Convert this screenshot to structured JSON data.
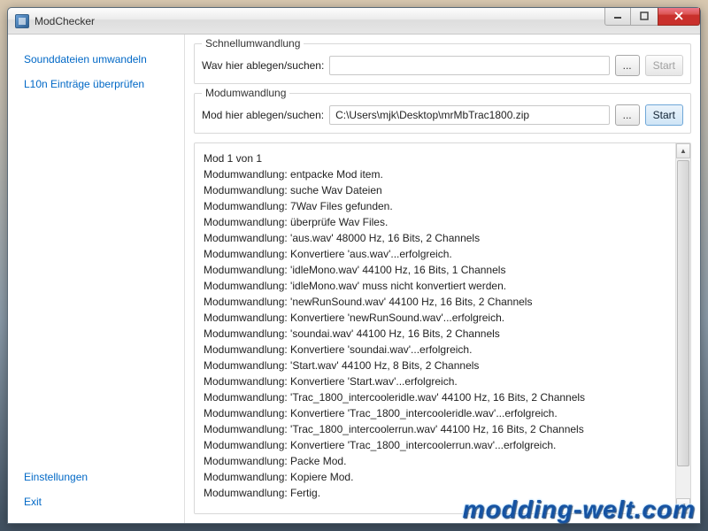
{
  "window": {
    "title": "ModChecker"
  },
  "sidebar": {
    "top": [
      {
        "label": "Sounddateien umwandeln"
      },
      {
        "label": "L10n Einträge überprüfen"
      }
    ],
    "bottom": [
      {
        "label": "Einstellungen"
      },
      {
        "label": "Exit"
      }
    ]
  },
  "quick": {
    "title": "Schnellumwandlung",
    "label": "Wav hier ablegen/suchen:",
    "value": "",
    "browse": "...",
    "start": "Start"
  },
  "mod": {
    "title": "Modumwandlung",
    "label": "Mod hier ablegen/suchen:",
    "value": "C:\\Users\\mjk\\Desktop\\mrMbTrac1800.zip",
    "browse": "...",
    "start": "Start"
  },
  "log_lines": [
    "Mod 1 von 1",
    "Modumwandlung: entpacke Mod item.",
    "Modumwandlung: suche Wav Dateien",
    "Modumwandlung: 7Wav Files gefunden.",
    "Modumwandlung: überprüfe Wav Files.",
    "Modumwandlung: 'aus.wav' 48000 Hz, 16 Bits, 2 Channels",
    "Modumwandlung: Konvertiere 'aus.wav'...erfolgreich.",
    "Modumwandlung: 'idleMono.wav' 44100 Hz, 16 Bits, 1 Channels",
    "Modumwandlung: 'idleMono.wav' muss nicht konvertiert werden.",
    "Modumwandlung: 'newRunSound.wav' 44100 Hz, 16 Bits, 2 Channels",
    "Modumwandlung: Konvertiere 'newRunSound.wav'...erfolgreich.",
    "Modumwandlung: 'soundai.wav' 44100 Hz, 16 Bits, 2 Channels",
    "Modumwandlung: Konvertiere 'soundai.wav'...erfolgreich.",
    "Modumwandlung: 'Start.wav' 44100 Hz, 8 Bits, 2 Channels",
    "Modumwandlung: Konvertiere 'Start.wav'...erfolgreich.",
    "Modumwandlung: 'Trac_1800_intercooleridle.wav' 44100 Hz, 16 Bits, 2 Channels",
    "Modumwandlung: Konvertiere 'Trac_1800_intercooleridle.wav'...erfolgreich.",
    "Modumwandlung: 'Trac_1800_intercoolerrun.wav' 44100 Hz, 16 Bits, 2 Channels",
    "Modumwandlung: Konvertiere 'Trac_1800_intercoolerrun.wav'...erfolgreich.",
    "Modumwandlung: Packe Mod.",
    "Modumwandlung: Kopiere Mod.",
    "Modumwandlung: Fertig."
  ],
  "watermark": "modding-welt.com"
}
